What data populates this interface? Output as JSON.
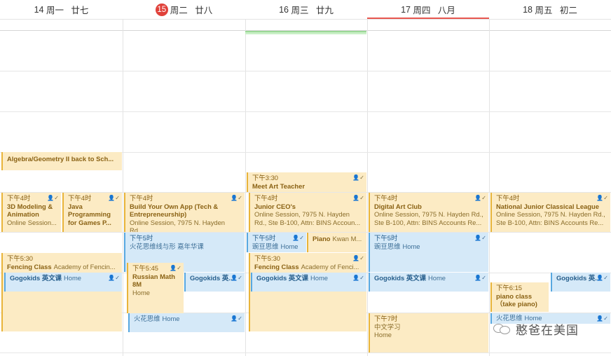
{
  "days": [
    {
      "num": "14",
      "weekday": "周一",
      "lunar": "廿七"
    },
    {
      "num": "15",
      "weekday": "周二",
      "lunar": "廿八"
    },
    {
      "num": "16",
      "weekday": "周三",
      "lunar": "廿九"
    },
    {
      "num": "17",
      "weekday": "周四",
      "lunar": "八月"
    },
    {
      "num": "18",
      "weekday": "周五",
      "lunar": "初二"
    }
  ],
  "events": {
    "mon_algebra": {
      "title": "Algebra/Geometry II back to Sch..."
    },
    "mon_3d": {
      "time": "下午4时",
      "title": "3D Modeling &",
      "title2": "Animation",
      "sub": "Online Session..."
    },
    "mon_java": {
      "time": "下午4时",
      "title": "Java",
      "title2": "Programming",
      "title3": "for Games P..."
    },
    "mon_fencing": {
      "time": "下午5:30",
      "title": "Fencing Class",
      "sub": "Academy of Fencin..."
    },
    "mon_gogo": {
      "title": "Gogokids 英文课",
      "sub": "Home"
    },
    "tue_build": {
      "time": "下午4时",
      "title": "Build Your Own App (Tech &",
      "title2": "Entrepreneurship)",
      "sub": "Online Session, 7975 N. Hayden Rd...."
    },
    "tue_huohua1": {
      "time": "下午5时",
      "title": "火花思维线与形 嘉年华课"
    },
    "tue_russian": {
      "time": "下午5:45",
      "title": "Russian Math",
      "title2": "8M",
      "sub": "Home"
    },
    "tue_gogo": {
      "title": "Gogokids 英..."
    },
    "tue_huohua2": {
      "title": "火花思维",
      "sub": "Home"
    },
    "wed_art": {
      "time": "下午3:30",
      "title": "Meet Art Teacher"
    },
    "wed_ceo": {
      "time": "下午4时",
      "title": "Junior CEO's",
      "sub": "Online Session, 7975 N. Hayden",
      "sub2": "Rd., Ste B-100, Attn: BINS Accoun..."
    },
    "wed_wandou": {
      "time": "下午5时",
      "title": "豌豆思维",
      "sub": "Home"
    },
    "wed_piano": {
      "title": "Piano",
      "sub": "Kwan M..."
    },
    "wed_fencing": {
      "time": "下午5:30",
      "title": "Fencing Class",
      "sub": "Academy of Fenci..."
    },
    "wed_gogo": {
      "title": "Gogokids 英文课",
      "sub": "Home"
    },
    "thu_art": {
      "time": "下午4时",
      "title": "Digital Art Club",
      "sub": "Online Session, 7975 N. Hayden Rd.,",
      "sub2": "Ste B-100, Attn: BINS Accounts Re..."
    },
    "thu_wandou": {
      "time": "下午5时",
      "title": "豌豆思维",
      "sub": "Home"
    },
    "thu_gogo": {
      "title": "Gogokids 英文课",
      "sub": "Home"
    },
    "thu_chinese": {
      "time": "下午7时",
      "title": "中文学习",
      "sub": "Home"
    },
    "fri_njcl": {
      "time": "下午4时",
      "title": "National Junior Classical League",
      "sub": "Online Session, 7975 N. Hayden Rd.,",
      "sub2": "Ste B-100, Attn: BINS Accounts Re..."
    },
    "fri_gogo": {
      "title": "Gogokids 英..."
    },
    "fri_piano": {
      "time": "下午6:15",
      "title": "piano class",
      "title2": "（take piano)"
    },
    "fri_huohua": {
      "title": "火花思维",
      "sub": "Home"
    }
  },
  "watermark": {
    "text": "憨爸在美国"
  },
  "colors": {
    "yellow_bg": "#fcebc4",
    "yellow_bar": "#e8b43a",
    "blue_bg": "#d5e9f8",
    "blue_bar": "#58a8e0",
    "today_red": "#e0413a"
  }
}
